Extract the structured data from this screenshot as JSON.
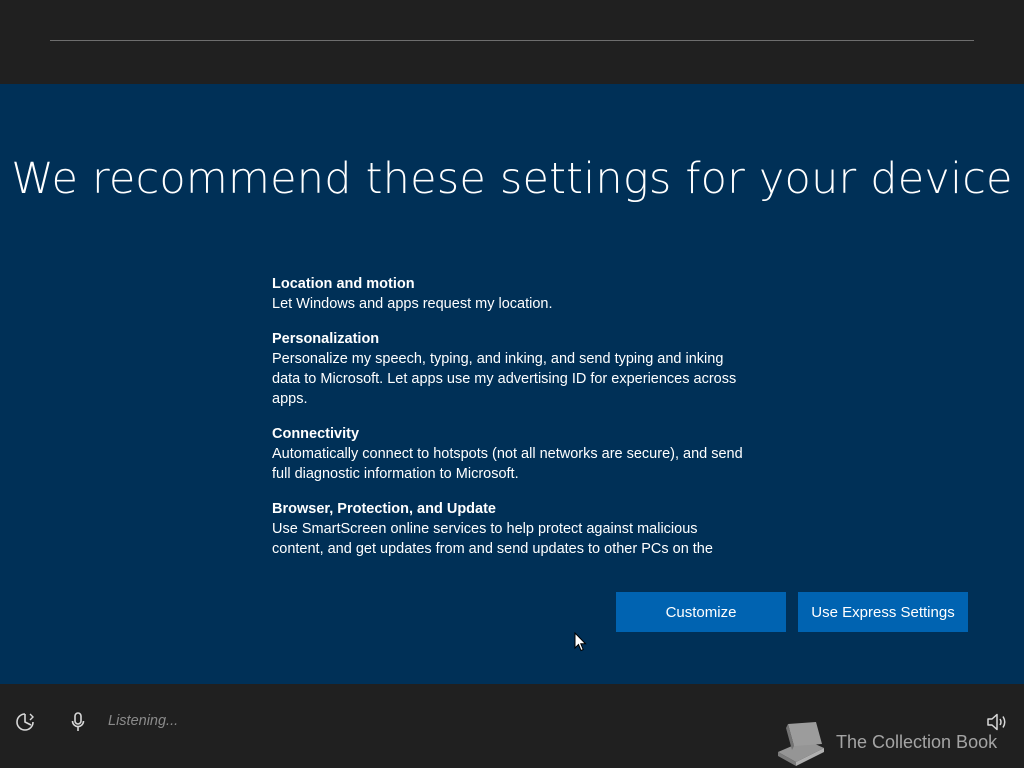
{
  "title": "We recommend these settings for your device",
  "settings": [
    {
      "heading": "Location and motion",
      "description": "Let Windows and apps request my location."
    },
    {
      "heading": "Personalization",
      "description": "Personalize my speech, typing, and inking, and send typing and inking data to Microsoft. Let apps use my advertising ID for experiences across apps."
    },
    {
      "heading": "Connectivity",
      "description": "Automatically connect to hotspots (not all networks are secure), and send full diagnostic information to Microsoft."
    },
    {
      "heading": "Browser, Protection, and Update",
      "description": "Use SmartScreen online services to help protect against malicious content, and get updates from and send updates to other PCs on the Internet."
    }
  ],
  "buttons": {
    "customize": "Customize",
    "express": "Use Express Settings"
  },
  "bottom_bar": {
    "listening": "Listening...",
    "icons": {
      "ease_of_access": "ease-of-access-icon",
      "microphone": "microphone-icon",
      "volume": "volume-icon"
    }
  },
  "watermark": {
    "text": "The Collection Book"
  },
  "colors": {
    "panel_background": "#003057",
    "chrome_background": "#202020",
    "button_accent": "#0063b1",
    "text_primary": "#ffffff",
    "text_muted": "#8a8a8a"
  }
}
